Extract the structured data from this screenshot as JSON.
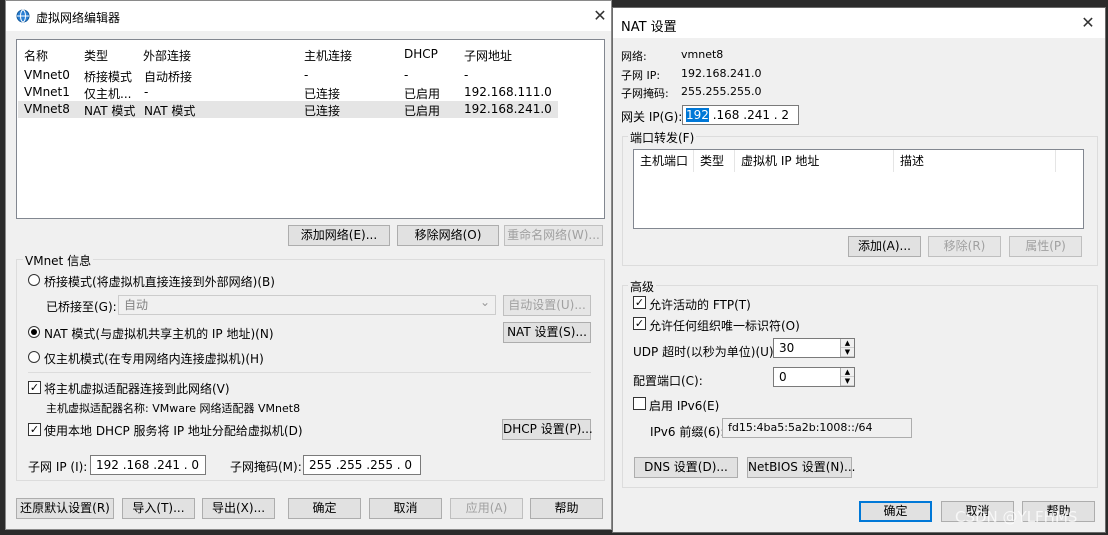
{
  "left": {
    "title": "虚拟网络编辑器",
    "columns": [
      "名称",
      "类型",
      "外部连接",
      "主机连接",
      "DHCP",
      "子网地址"
    ],
    "rows": [
      [
        "VMnet0",
        "桥接模式",
        "自动桥接",
        "-",
        "-",
        "-"
      ],
      [
        "VMnet1",
        "仅主机...",
        "-",
        "已连接",
        "已启用",
        "192.168.111.0"
      ],
      [
        "VMnet8",
        "NAT 模式",
        "NAT 模式",
        "已连接",
        "已启用",
        "192.168.241.0"
      ]
    ],
    "add_network": "添加网络(E)...",
    "remove_network": "移除网络(O)",
    "rename_network": "重命名网络(W)...",
    "vmnet_info": "VMnet 信息",
    "bridge_mode": "桥接模式(将虚拟机直接连接到外部网络)(B)",
    "bridged_to_label": "已桥接至(G):",
    "bridged_to_value": "自动",
    "auto_settings": "自动设置(U)...",
    "nat_mode": "NAT 模式(与虚拟机共享主机的 IP 地址)(N)",
    "nat_settings": "NAT 设置(S)...",
    "host_only": "仅主机模式(在专用网络内连接虚拟机)(H)",
    "connect_adapter": "将主机虚拟适配器连接到此网络(V)",
    "adapter_name": "主机虚拟适配器名称: VMware 网络适配器 VMnet8",
    "use_dhcp": "使用本地 DHCP 服务将 IP 地址分配给虚拟机(D)",
    "dhcp_settings": "DHCP 设置(P)...",
    "subnet_ip_label": "子网 IP (I):",
    "subnet_ip": "192 .168 .241 .  0",
    "subnet_mask_label": "子网掩码(M):",
    "subnet_mask": "255 .255 .255 .  0",
    "restore_defaults": "还原默认设置(R)",
    "import": "导入(T)...",
    "export": "导出(X)...",
    "ok": "确定",
    "cancel": "取消",
    "apply": "应用(A)",
    "help": "帮助"
  },
  "nat": {
    "title": "NAT 设置",
    "network_label": "网络:",
    "network_value": "vmnet8",
    "subnet_ip_label": "子网 IP:",
    "subnet_ip_value": "192.168.241.0",
    "subnet_mask_label": "子网掩码:",
    "subnet_mask_value": "255.255.255.0",
    "gateway_label": "网关 IP(G):",
    "gateway_first": "192",
    "gateway_rest": " .168 .241 .  2",
    "port_forwarding": "端口转发(F)",
    "pf_columns": [
      "主机端口",
      "类型",
      "虚拟机 IP 地址",
      "描述"
    ],
    "add": "添加(A)...",
    "remove": "移除(R)",
    "properties": "属性(P)",
    "advanced": "高级",
    "allow_ftp": "允许活动的 FTP(T)",
    "allow_org_id": "允许任何组织唯一标识符(O)",
    "udp_timeout_label": "UDP 超时(以秒为单位)(U):",
    "udp_timeout": "30",
    "config_port_label": "配置端口(C):",
    "config_port": "0",
    "enable_ipv6": "启用 IPv6(E)",
    "ipv6_prefix_label": "IPv6 前缀(6):",
    "ipv6_prefix": "fd15:4ba5:5a2b:1008::/64",
    "dns_settings": "DNS 设置(D)...",
    "netbios_settings": "NetBIOS 设置(N)...",
    "ok": "确定",
    "cancel": "取消",
    "help": "帮助"
  },
  "watermark": "CSDN @YLFHMS",
  "close_glyph": "✕",
  "check_glyph": "✓",
  "arrow_up": "▲",
  "arrow_down": "▼",
  "chevron": "⌄"
}
